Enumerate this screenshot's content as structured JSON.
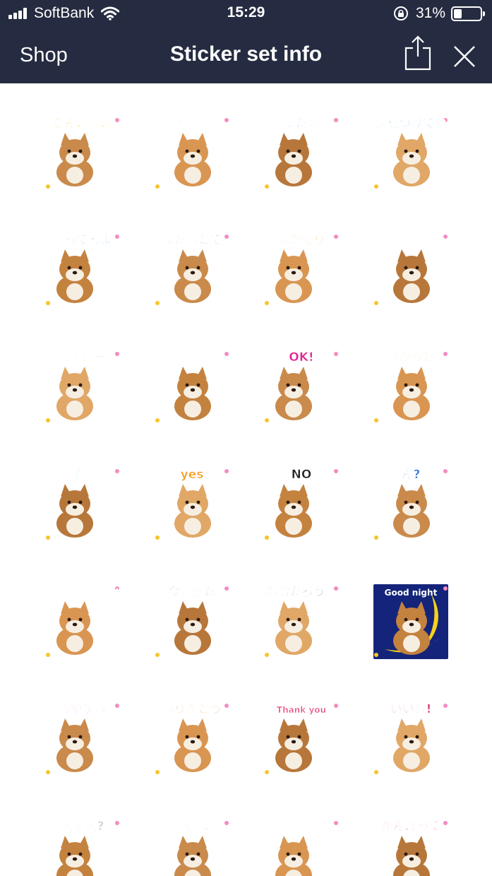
{
  "status_bar": {
    "carrier": "SoftBank",
    "time": "15:29",
    "battery_percent": "31%",
    "battery_level": 0.31
  },
  "nav": {
    "back_label": "Shop",
    "title": "Sticker set info",
    "share_icon": "share-icon",
    "close_icon": "close-icon"
  },
  "colors": {
    "nav_bg": "#252c41",
    "page_bg": "#ffffff"
  },
  "stickers": [
    {
      "caption": "こんにちは",
      "color": "#e6b400"
    },
    {
      "caption": "いってらっしゃい",
      "color": "#f08a24"
    },
    {
      "caption": "またね",
      "color": "#2f6fd6"
    },
    {
      "caption": "気をつけてね",
      "color": "#3a8fd0"
    },
    {
      "caption": "待ってるよ",
      "color": "#3c8ee0"
    },
    {
      "caption": "またあとで",
      "color": "#4f8fd6"
    },
    {
      "caption": "おかえり",
      "color": "#e6a400"
    },
    {
      "caption": "おつかれさまです",
      "color": "#e6a400"
    },
    {
      "caption": "あそぼー",
      "color": "#f5c890"
    },
    {
      "caption": "わーい わーい",
      "color": "#c13ccf"
    },
    {
      "caption": "OK!",
      "color": "#e21f8f"
    },
    {
      "caption": "わかった",
      "color": "#8ccd3c"
    },
    {
      "caption": "了解",
      "color": "#2cc970"
    },
    {
      "caption": "yes",
      "color": "#f59a1e"
    },
    {
      "caption": "NO",
      "color": "#222222"
    },
    {
      "caption": "ん?",
      "color": "#2f6fd6"
    },
    {
      "caption": "おはようございます",
      "color": "#f07fb3"
    },
    {
      "caption": "今起きた",
      "color": "#2f5fd6"
    },
    {
      "caption": "ねむたろう。",
      "color": "#2b3fae"
    },
    {
      "caption": "Good night",
      "color": "#1d2f9a"
    },
    {
      "caption": "おやすみ",
      "color": "#d94fc8"
    },
    {
      "caption": "ありがとう",
      "color": "#f26b1d"
    },
    {
      "caption": "Thank you",
      "color": "#e8447a"
    },
    {
      "caption": "いいね!",
      "color": "#e0306f"
    },
    {
      "caption": "大丈夫?",
      "color": "#cfcfcf"
    },
    {
      "caption": "お大事に",
      "color": "#bdbdbd"
    },
    {
      "caption": "",
      "color": "#f48cc0"
    },
    {
      "caption": "がんばって",
      "color": "#e5202b"
    }
  ]
}
